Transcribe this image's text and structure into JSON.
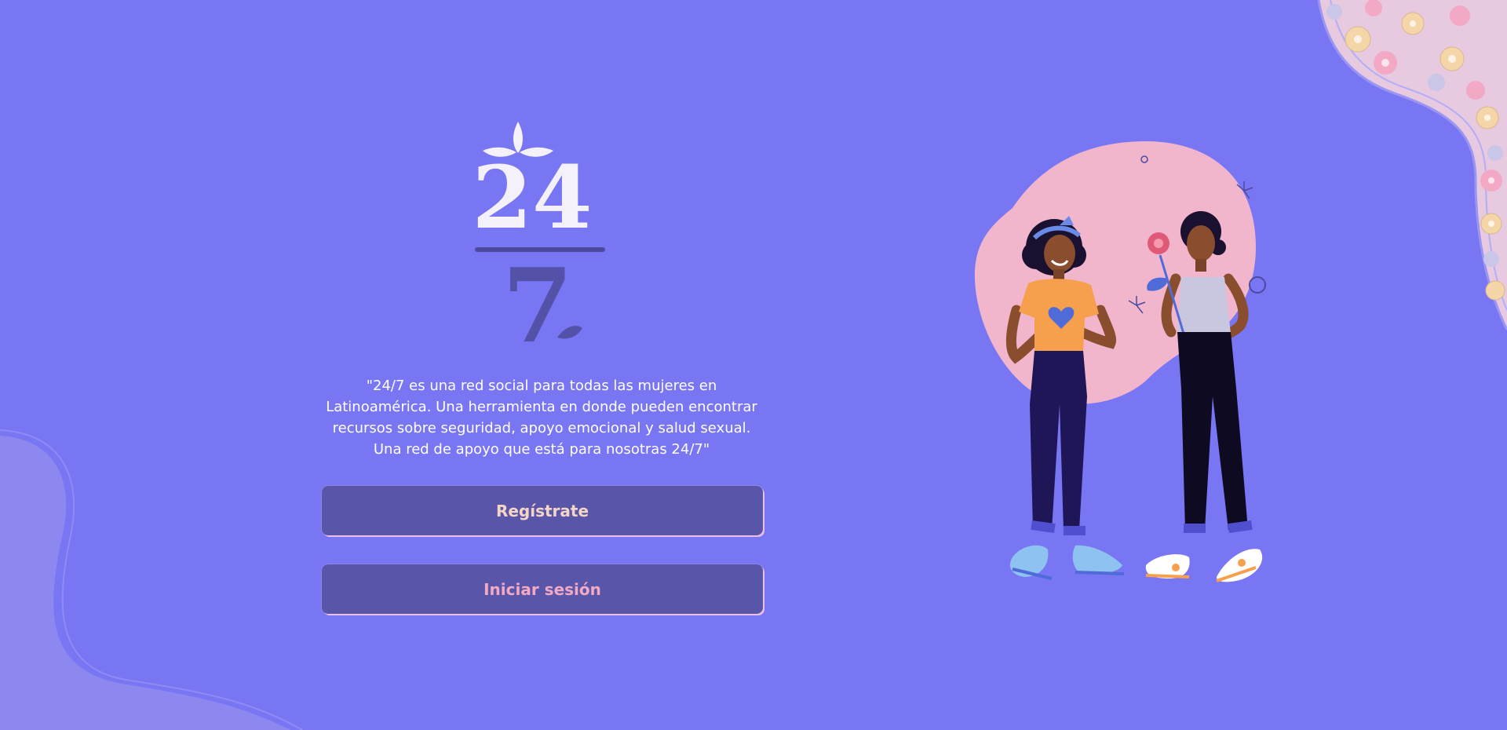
{
  "logo": {
    "top_text": "24",
    "bottom_text": "7",
    "icon": "leaf-sprout-icon"
  },
  "tagline": {
    "lines": [
      "\"24/7 es una red social para todas las mujeres en",
      "Latinoamérica. Una herramienta en donde pueden encontrar",
      "recursos sobre seguridad, apoyo emocional y salud sexual.",
      "Una red de apoyo que está para nosotras 24/7\""
    ]
  },
  "buttons": {
    "register_label": "Regístrate",
    "login_label": "Iniciar sesión"
  },
  "colors": {
    "background": "#7976F4",
    "button_bg": "#5956A9",
    "register_text": "#F5D6C6",
    "login_text": "#F2A9C4",
    "blob_pink": "#F1B6CC",
    "logo_light": "#F4F1FA",
    "logo_dark": "#5452A8"
  },
  "illustration": {
    "icon": "two-women-friends-illustration"
  }
}
